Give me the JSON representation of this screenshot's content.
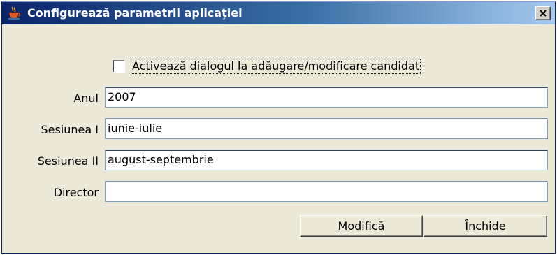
{
  "window": {
    "title": "Configurează parametrii aplicației",
    "close_glyph": "×"
  },
  "options": {
    "dialog_checkbox": {
      "label": "Activează dialogul la adăugare/modificare candidat",
      "checked": false
    }
  },
  "fields": {
    "anul": {
      "label": "Anul",
      "value": "2007"
    },
    "sesiunea1": {
      "label": "Sesiunea I",
      "value": "iunie-iulie"
    },
    "sesiunea2": {
      "label": "Sesiunea II",
      "value": "august-septembrie"
    },
    "director": {
      "label": "Director",
      "value": ""
    }
  },
  "buttons": {
    "modify": {
      "mnemonic": "M",
      "rest": "odifică"
    },
    "close": {
      "prefix": "Î",
      "mnemonic": "n",
      "rest": "chide"
    }
  },
  "colors": {
    "titlebar_start": "#0A246A",
    "titlebar_end": "#A6CAF0",
    "window_bg": "#ECE9D8"
  }
}
